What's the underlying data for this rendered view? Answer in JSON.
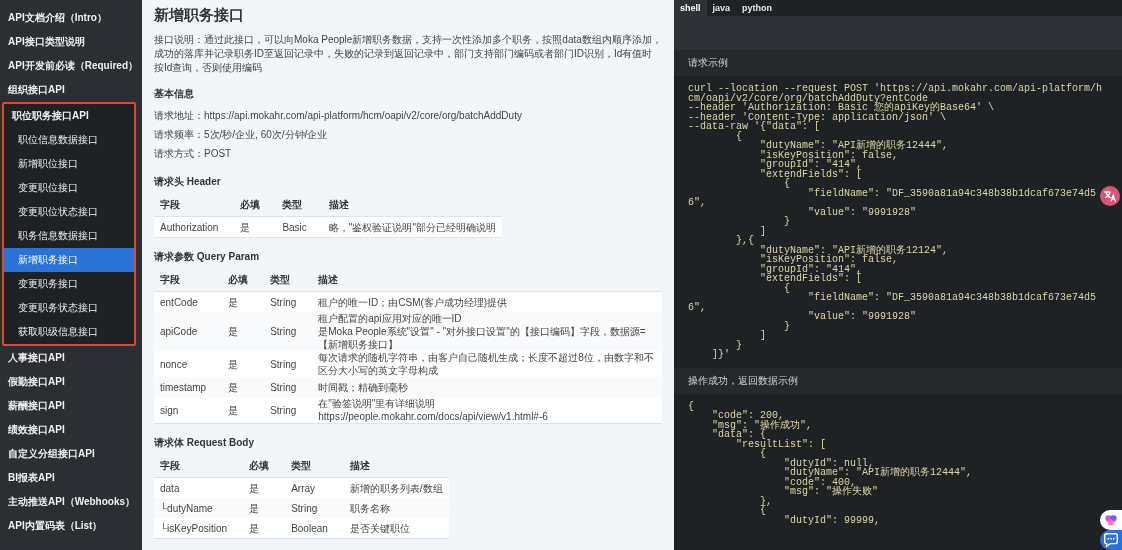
{
  "sidebar": {
    "items": [
      {
        "label": "API文档介绍（Intro）",
        "selected": false
      },
      {
        "label": "API接口类型说明",
        "selected": false
      },
      {
        "label": "API开发前必读（Required）",
        "selected": false
      },
      {
        "label": "组织接口API",
        "selected": false
      },
      {
        "label": "职位职务接口API",
        "selected": false,
        "expanded": true,
        "highlighted": true,
        "children": [
          {
            "label": "职位信息数据接口",
            "selected": false
          },
          {
            "label": "新增职位接口",
            "selected": false
          },
          {
            "label": "变更职位接口",
            "selected": false
          },
          {
            "label": "变更职位状态接口",
            "selected": false
          },
          {
            "label": "职务信息数据接口",
            "selected": false
          },
          {
            "label": "新增职务接口",
            "selected": true
          },
          {
            "label": "变更职务接口",
            "selected": false
          },
          {
            "label": "变更职务状态接口",
            "selected": false
          },
          {
            "label": "获取职级信息接口",
            "selected": false
          }
        ]
      },
      {
        "label": "人事接口API",
        "selected": false
      },
      {
        "label": "假勤接口API",
        "selected": false
      },
      {
        "label": "薪酬接口API",
        "selected": false
      },
      {
        "label": "绩效接口API",
        "selected": false
      },
      {
        "label": "自定义分组接口API",
        "selected": false
      },
      {
        "label": "BI报表API",
        "selected": false
      },
      {
        "label": "主动推送API（Webhooks）",
        "selected": false
      },
      {
        "label": "API内置码表（List）",
        "selected": false
      }
    ]
  },
  "main": {
    "title": "新增职务接口",
    "description": "接口说明：通过此接口，可以向Moka People新增职务数据，支持一次性添加多个职务，按照data数组内顺序添加，成功的落库并记录职务ID至返回记录中，失败的记录到返回记录中，部门支持部门编码或者部门ID识别，Id有值时按Id查询，否则使用编码",
    "basic_info": {
      "heading": "基本信息",
      "lines": [
        "请求地址：https://api.mokahr.com/api-platform/hcm/oapi/v2/core/org/batchAddDuty",
        "请求频率：5次/秒/企业, 60次/分钟/企业",
        "请求方式：POST"
      ]
    },
    "tables": [
      {
        "heading": "请求头 Header",
        "columns": [
          "字段",
          "必填",
          "类型",
          "描述"
        ],
        "rows": [
          [
            "Authorization",
            "是",
            "Basic",
            "略，\"鉴权验证说明\"部分已经明确说明"
          ]
        ]
      },
      {
        "heading": "请求参数 Query Param",
        "columns": [
          "字段",
          "必填",
          "类型",
          "描述"
        ],
        "rows": [
          [
            "entCode",
            "是",
            "String",
            "租户的唯一ID；由CSM(客户成功经理)提供"
          ],
          [
            "apiCode",
            "是",
            "String",
            "租户配置的api应用对应的唯一ID\n是Moka People系统\"设置\" - \"对外接口设置\"的【接口编码】字段，数据源=【新增职务接口】"
          ],
          [
            "nonce",
            "是",
            "String",
            "每次请求的随机字符串，由客户自己随机生成；长度不超过8位，由数字和不区分大小写的英文字母构成"
          ],
          [
            "timestamp",
            "是",
            "String",
            "时间戳；精确到毫秒"
          ],
          [
            "sign",
            "是",
            "String",
            "在\"验签说明\"里有详细说明\nhttps://people.mokahr.com/docs/api/view/v1.html#-6"
          ]
        ]
      },
      {
        "heading": "请求体 Request Body",
        "columns": [
          "字段",
          "必填",
          "类型",
          "描述"
        ],
        "rows": [
          [
            "data",
            "是",
            "Array",
            "新增的职务列表/数组"
          ],
          [
            "└dutyName",
            "是",
            "String",
            "职务名称"
          ],
          [
            "└isKeyPosition",
            "是",
            "Boolean",
            "是否关键职位"
          ]
        ]
      }
    ]
  },
  "code_panel": {
    "tabs": [
      {
        "label": "shell",
        "selected": true
      },
      {
        "label": "java",
        "selected": false
      },
      {
        "label": "python",
        "selected": false
      }
    ],
    "request_example": {
      "heading": "请求示例",
      "lines": [
        "curl --location --request POST 'https://api.mokahr.com/api-platform/hcm/oapi/v2/core/org/batchAddDuty?entCode",
        "--header 'Authorization: Basic 您的apiKey的Base64' \\",
        "--header 'Content-Type: application/json' \\",
        "--data-raw '{\"data\": [",
        "        {",
        "            \"dutyName\": \"API新增的职务12444\",",
        "            \"isKeyPosition\": false,",
        "            \"groupId\": \"414\",",
        "            \"extendFields\": [",
        "                {",
        "                    \"fieldName\": \"DF_3590a81a94c348b38b1dcaf673e74d56\",",
        "                    \"value\": \"9991928\"",
        "                }",
        "            ]",
        "        },{",
        "            \"dutyName\": \"API新增的职务12124\",",
        "            \"isKeyPosition\": false,",
        "            \"groupId\": \"414\",",
        "            \"extendFields\": [",
        "                {",
        "                    \"fieldName\": \"DF_3590a81a94c348b38b1dcaf673e74d56\",",
        "                    \"value\": \"9991928\"",
        "                }",
        "            ]",
        "        }",
        "    ]}'"
      ]
    },
    "response_example": {
      "heading": "操作成功，返回数据示例",
      "lines": [
        "{",
        "    \"code\": 200,",
        "    \"msg\": \"操作成功\",",
        "    \"data\": {",
        "        \"resultList\": [",
        "            {",
        "                \"dutyId\": null,",
        "                \"dutyName\": \"API新增的职务12444\",",
        "                \"code\": 400,",
        "                \"msg\": \"操作失败\"",
        "            },",
        "            {",
        "                \"dutyId\": 99999,"
      ]
    }
  }
}
